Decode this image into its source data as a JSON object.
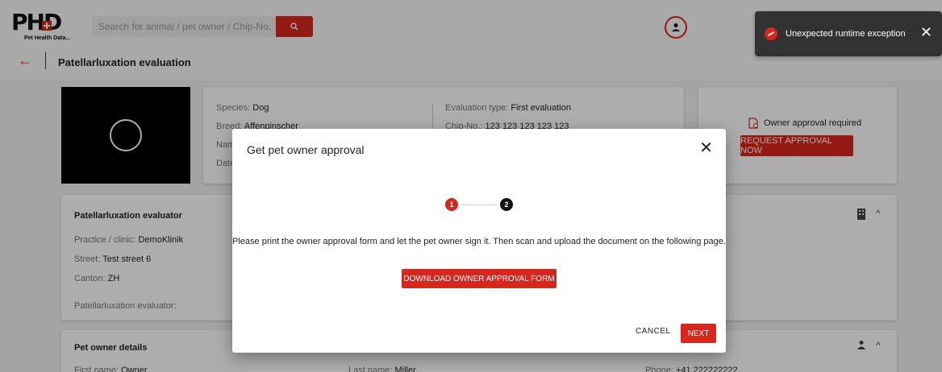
{
  "header": {
    "logo_text": "PHD",
    "logo_subtitle": "Pet Health Data...",
    "search": {
      "placeholder": "Search for animal / pet owner / Chip-No."
    },
    "icons": {
      "search": "search-icon",
      "user": "user-circle-icon"
    }
  },
  "toast": {
    "message": "Unexpected runtime exception",
    "close": "✕"
  },
  "page": {
    "title": "Patellarluxation evaluation",
    "back": "←"
  },
  "pet": {
    "species_label": "Species:",
    "species": "Dog",
    "breed_label": "Breed:",
    "breed": "Affenpinscher",
    "name_label": "Nam",
    "date_label": "Date",
    "evaluation_type_label": "Evaluation type:",
    "evaluation_type": "First evaluation",
    "chip_label": "Chip-No.:",
    "chip": "123 123 123 123 123"
  },
  "approval": {
    "required_text": "Owner approval required",
    "request_button": "REQUEST APPROVAL NOW"
  },
  "evaluator": {
    "title": "Patellarluxation evaluator",
    "practice_label": "Practice / clinic:",
    "practice": "DemoKlinik",
    "street_label": "Street:",
    "street": "Test street 6",
    "canton_label": "Canton:",
    "canton": "ZH",
    "evaluator_label": "Patellarluxation evaluator:"
  },
  "owner": {
    "title": "Pet owner details",
    "first_name_label": "First name:",
    "first_name": "Owner",
    "last_name_label": "Last name:",
    "last_name": "Miller",
    "phone_label": "Phone:",
    "phone": "+41 222222222"
  },
  "modal": {
    "title": "Get pet owner approval",
    "close": "✕",
    "steps": [
      "1",
      "2"
    ],
    "active_step": 1,
    "instructions": "Please print the owner approval form and let the pet owner sign it. Then scan and upload the document on the following page.",
    "download_button": "DOWNLOAD OWNER APPROVAL FORM",
    "cancel_button": "CANCEL",
    "next_button": "NEXT"
  },
  "colors": {
    "accent": "#d9261c",
    "toast_bg": "#323232"
  }
}
